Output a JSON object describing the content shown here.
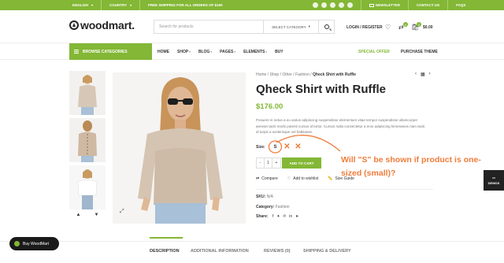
{
  "topbar": {
    "language": "ENGLISH",
    "country": "COUNTRY",
    "shipping": "FREE SHIPPING FOR ALL ORDERS OF $150",
    "newsletter": "NEWSLETTER",
    "contact": "CONTACT US",
    "faqs": "FAQS"
  },
  "header": {
    "logo": "woodmart.",
    "search_placeholder": "Search for products",
    "category": "SELECT CATEGORY",
    "account": "LOGIN / REGISTER",
    "wishlist_count": "0",
    "cart_count": "0",
    "cart_total": "$0.00"
  },
  "nav": {
    "browse": "BROWSE CATEGORIES",
    "items": [
      "HOME",
      "SHOP",
      "BLOG",
      "PAGES",
      "ELEMENTS",
      "BUY"
    ],
    "special": "SPECIAL OFFER",
    "purchase": "PURCHASE THEME"
  },
  "breadcrumb": {
    "items": [
      "Home",
      "Shop",
      "Other",
      "Fashion"
    ],
    "current": "Qheck Shirt with Ruffle"
  },
  "product": {
    "title": "Qheck Shirt with Ruffle",
    "price": "$176.00",
    "description": "Posuere in netus a eu varius adipiscing suspendisse elementum vitae tempor suspendisse ullamcorper aenean taciti morbi potenti cursus id tortor. Cursus nulla consectetur a eros adipiscing himenaeos nam taciti id turpis a scelerisque vel habitasse.",
    "size_label": "Size:",
    "size_selected": "S",
    "quantity": "1",
    "qty_minus": "-",
    "qty_plus": "+",
    "add_to_cart": "ADD TO CART",
    "compare": "Compare",
    "wishlist": "Add to wishlist",
    "size_guide": "Size Guide",
    "sku_label": "SKU:",
    "sku_value": "N/A",
    "category_label": "Category:",
    "category_value": "Fashion",
    "share_label": "Share:"
  },
  "annotation": {
    "text": "Will \"S\" be shown if product is one-sized (small)?",
    "color": "#f07c3b"
  },
  "tabs": [
    "DESCRIPTION",
    "ADDITIONAL INFORMATION",
    "REVIEWS (0)",
    "SHIPPING & DELIVERY"
  ],
  "buy_button": "Buy WoodMart",
  "demos": "DEMOS",
  "colors": {
    "accent": "#83b735",
    "dark": "#242424"
  }
}
